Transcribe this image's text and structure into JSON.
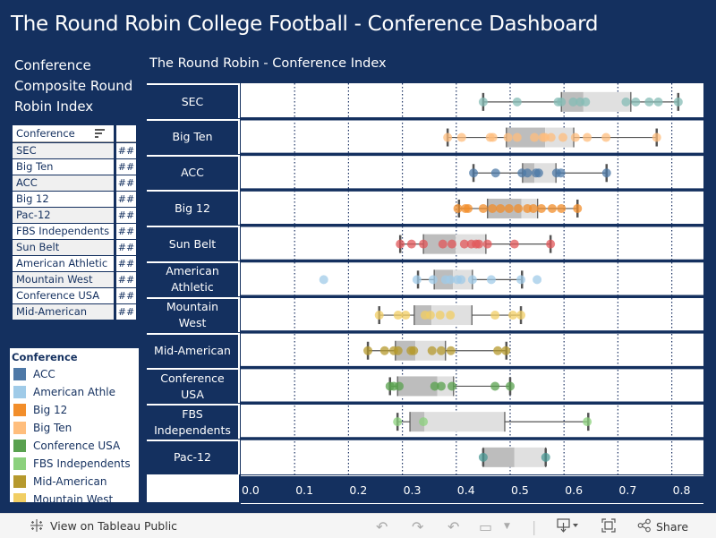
{
  "header": {
    "title": "The Round Robin College Football - Conference Dashboard"
  },
  "sidebar": {
    "title": "Conference Composite Round Robin Index",
    "table": {
      "column_header": "Conference",
      "sort_icon": "sort-descending-icon",
      "rows": [
        {
          "conference": "SEC",
          "value": "##"
        },
        {
          "conference": "Big Ten",
          "value": "##"
        },
        {
          "conference": "ACC",
          "value": "##"
        },
        {
          "conference": "Big 12",
          "value": "##"
        },
        {
          "conference": "Pac-12",
          "value": "##"
        },
        {
          "conference": "FBS Independents",
          "value": "##"
        },
        {
          "conference": "Sun Belt",
          "value": "##"
        },
        {
          "conference": "American Athletic",
          "value": "##"
        },
        {
          "conference": "Mountain West",
          "value": "##"
        },
        {
          "conference": "Conference USA",
          "value": "##"
        },
        {
          "conference": "Mid-American",
          "value": "##"
        }
      ]
    },
    "legend": {
      "title": "Conference",
      "items": [
        {
          "label": "ACC",
          "color": "#4E79A7"
        },
        {
          "label": "American Athle",
          "color": "#A0CBE8"
        },
        {
          "label": "Big 12",
          "color": "#F28E2B"
        },
        {
          "label": "Big Ten",
          "color": "#FFBE7D"
        },
        {
          "label": "Conference USA",
          "color": "#59A14F"
        },
        {
          "label": "FBS Independents",
          "color": "#8CD17D"
        },
        {
          "label": "Mid-American",
          "color": "#B6992D"
        },
        {
          "label": "Mountain West",
          "color": "#F1CE63"
        }
      ]
    }
  },
  "chart_data": {
    "type": "scatter",
    "subtype": "box-and-whisker with jittered points",
    "title": "The Round Robin - Conference Index",
    "xlabel": "",
    "ylabel": "",
    "xlim": [
      0.0,
      0.8
    ],
    "x_ticks": [
      "0.0",
      "0.1",
      "0.2",
      "0.3",
      "0.4",
      "0.5",
      "0.6",
      "0.7",
      "0.8"
    ],
    "grid": "vertical dotted",
    "categories": [
      "SEC",
      "Big Ten",
      "ACC",
      "Big 12",
      "Sun Belt",
      "American Athletic",
      "Mountain West",
      "Mid-American",
      "Conference USA",
      "FBS Independents",
      "Pac-12"
    ],
    "category_labels": [
      "SEC",
      "Big Ten",
      "ACC",
      "Big 12",
      "Sun Belt",
      "American\nAthletic",
      "Mountain\nWest",
      "Mid-American",
      "Conference\nUSA",
      "FBS\nIndependents",
      "Pac-12"
    ],
    "series": [
      {
        "name": "SEC",
        "color": "#86BCB6",
        "points": [
          0.45,
          0.513,
          0.589,
          0.595,
          0.617,
          0.63,
          0.64,
          0.715,
          0.733,
          0.758,
          0.775,
          0.812
        ],
        "box": {
          "whisker_low": 0.45,
          "q1": 0.595,
          "median": 0.636,
          "q3": 0.724,
          "whisker_high": 0.812
        }
      },
      {
        "name": "Big Ten",
        "color": "#FFBE7D",
        "points": [
          0.384,
          0.41,
          0.463,
          0.468,
          0.496,
          0.513,
          0.545,
          0.561,
          0.565,
          0.576,
          0.598,
          0.621,
          0.643,
          0.678,
          0.772
        ],
        "box": {
          "whisker_low": 0.384,
          "q1": 0.493,
          "median": 0.565,
          "q3": 0.618,
          "whisker_high": 0.772
        }
      },
      {
        "name": "ACC",
        "color": "#4E79A7",
        "points": [
          0.432,
          0.473,
          0.522,
          0.532,
          0.548,
          0.553,
          0.586,
          0.594,
          0.679
        ],
        "box": {
          "whisker_low": 0.432,
          "q1": 0.523,
          "median": 0.545,
          "q3": 0.585,
          "whisker_high": 0.679
        }
      },
      {
        "name": "Big 12",
        "color": "#F28E2B",
        "points": [
          0.403,
          0.417,
          0.422,
          0.45,
          0.467,
          0.482,
          0.498,
          0.515,
          0.532,
          0.543,
          0.558,
          0.578,
          0.595,
          0.625
        ],
        "box": {
          "whisker_low": 0.405,
          "q1": 0.458,
          "median": 0.521,
          "q3": 0.551,
          "whisker_high": 0.625
        }
      },
      {
        "name": "Sun Belt",
        "color": "#E15759",
        "points": [
          0.296,
          0.317,
          0.339,
          0.375,
          0.392,
          0.415,
          0.428,
          0.437,
          0.442,
          0.458,
          0.508,
          0.575
        ],
        "box": {
          "whisker_low": 0.296,
          "q1": 0.339,
          "median": 0.399,
          "q3": 0.455,
          "whisker_high": 0.575
        }
      },
      {
        "name": "American Athletic",
        "color": "#A0CBE8",
        "points": [
          0.154,
          0.327,
          0.357,
          0.38,
          0.389,
          0.402,
          0.409,
          0.43,
          0.465,
          0.52,
          0.55
        ],
        "box": {
          "whisker_low": 0.329,
          "q1": 0.359,
          "median": 0.394,
          "q3": 0.43,
          "whisker_high": 0.522
        }
      },
      {
        "name": "Mountain West",
        "color": "#F1CE63",
        "points": [
          0.257,
          0.292,
          0.306,
          0.342,
          0.352,
          0.37,
          0.389,
          0.472,
          0.505,
          0.52
        ],
        "box": {
          "whisker_low": 0.257,
          "q1": 0.322,
          "median": 0.354,
          "q3": 0.429,
          "whisker_high": 0.52
        }
      },
      {
        "name": "Mid-American",
        "color": "#B6992D",
        "points": [
          0.236,
          0.267,
          0.284,
          0.292,
          0.316,
          0.321,
          0.355,
          0.372,
          0.39,
          0.477,
          0.492
        ],
        "box": {
          "whisker_low": 0.236,
          "q1": 0.287,
          "median": 0.324,
          "q3": 0.38,
          "whisker_high": 0.493
        }
      },
      {
        "name": "Conference USA",
        "color": "#59A14F",
        "points": [
          0.277,
          0.284,
          0.294,
          0.36,
          0.372,
          0.392,
          0.472,
          0.5
        ],
        "box": {
          "whisker_low": 0.277,
          "q1": 0.291,
          "median": 0.365,
          "q3": 0.395,
          "whisker_high": 0.5
        }
      },
      {
        "name": "FBS Independents",
        "color": "#8CD17D",
        "points": [
          0.291,
          0.339,
          0.643
        ],
        "box": {
          "whisker_low": 0.291,
          "q1": 0.314,
          "median": 0.341,
          "q3": 0.49,
          "whisker_high": 0.645
        }
      },
      {
        "name": "Pac-12",
        "color": "#499894",
        "points": [
          0.45,
          0.566
        ],
        "box": {
          "whisker_low": 0.45,
          "q1": 0.45,
          "median": 0.508,
          "q3": 0.566,
          "whisker_high": 0.566
        }
      }
    ]
  },
  "footer": {
    "view_link": "View on Tableau Public",
    "share_label": "Share",
    "icons": [
      "tableau-logo-icon",
      "undo-icon",
      "redo-icon",
      "revert-icon",
      "refresh-icon",
      "download-icon",
      "fullscreen-icon",
      "share-icon"
    ]
  }
}
